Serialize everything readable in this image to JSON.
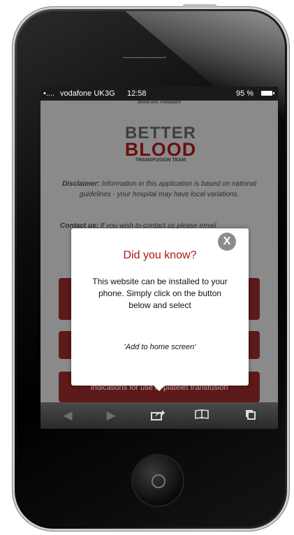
{
  "status_bar": {
    "signal": "•....",
    "carrier": "vodafone UK",
    "network": "3G",
    "time": "12:58",
    "battery": "95 %"
  },
  "background_page": {
    "subtitle": "Blood and Transplant",
    "logo": {
      "line1": "BETTER",
      "line2": "BLOOD",
      "line3": "TRANSFUSION TEAM"
    },
    "disclaimer_label": "Disclaimer:",
    "disclaimer_text": "Information in this application is based on national guidelines - your hospital may have local variations.",
    "contact_label": "Contact us:",
    "contact_text": "If you wish to contact us please email",
    "buttons": [
      "",
      "",
      "Indications for use of platelet transfusion"
    ]
  },
  "popup": {
    "title": "Did you know?",
    "body": "This website can be installed to your phone. Simply click on the button below and select",
    "hint": "'Add to home screen'",
    "close_label": "X"
  },
  "toolbar": {
    "back_icon": "back-arrow",
    "forward_icon": "forward-arrow",
    "share_icon": "share",
    "bookmarks_icon": "bookmarks",
    "tabs_icon": "tabs"
  }
}
